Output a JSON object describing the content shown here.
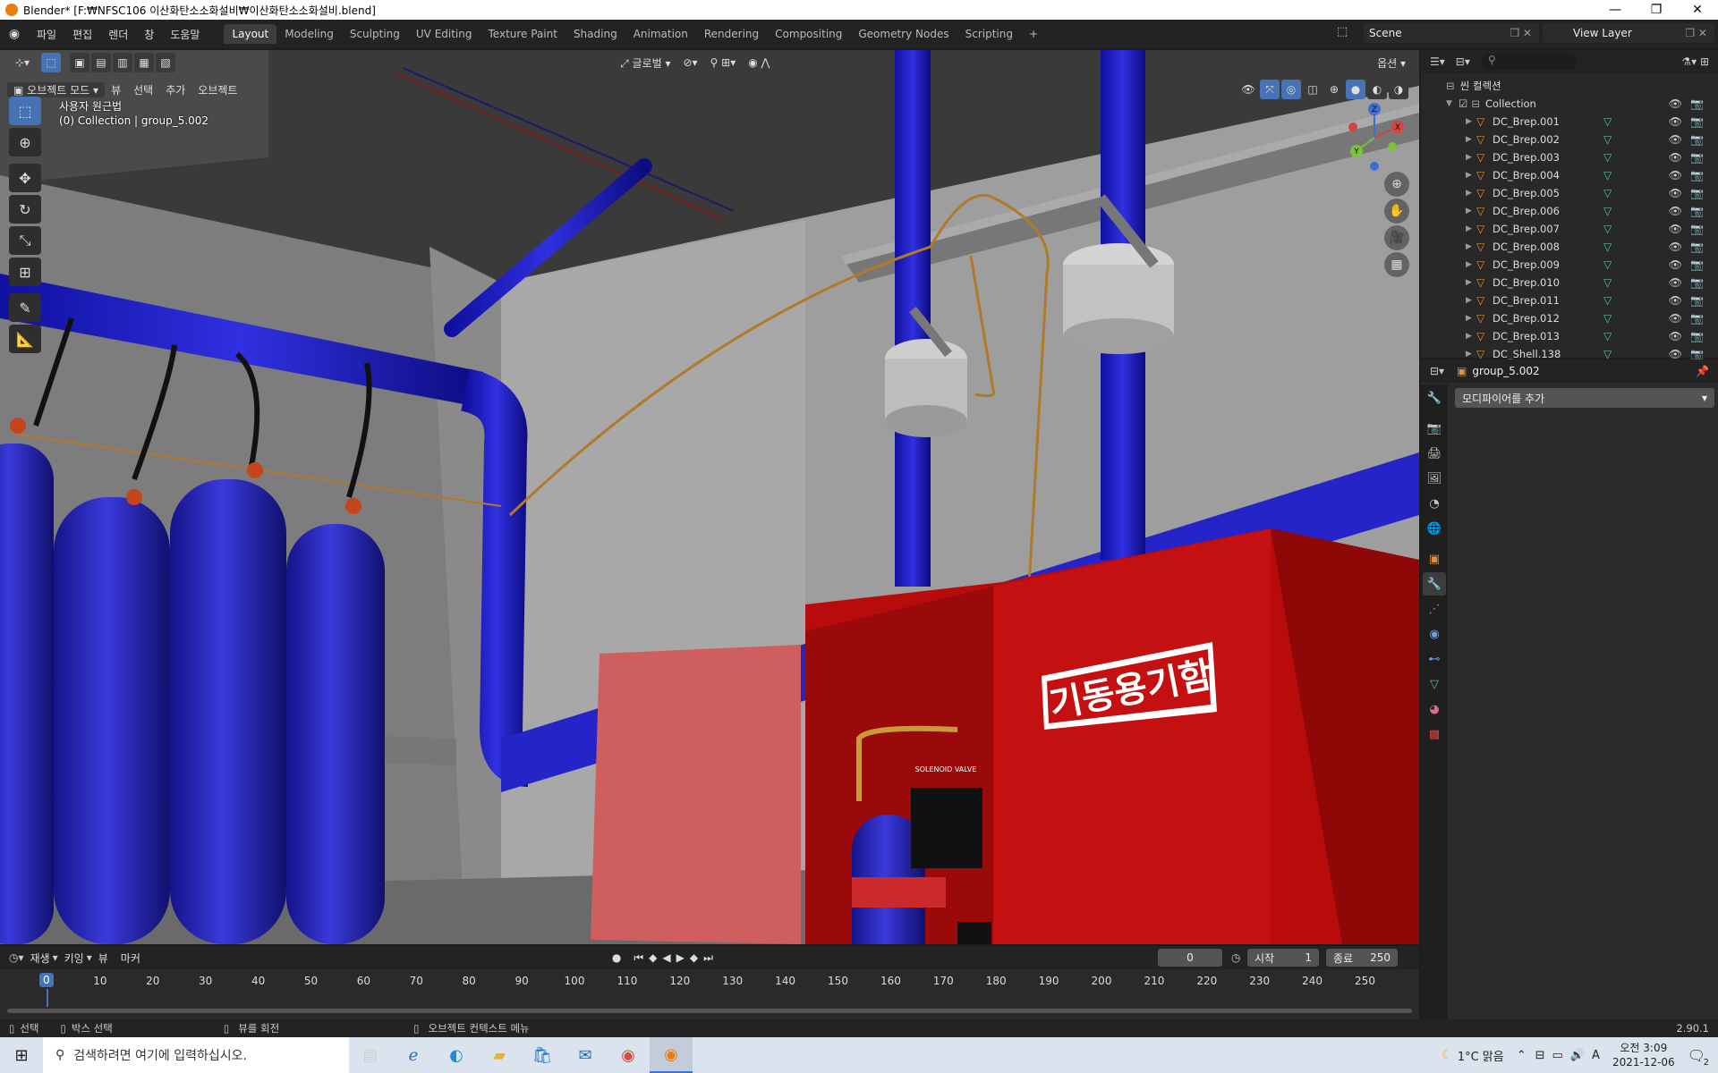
{
  "window": {
    "title": "Blender* [F:₩NFSC106 이산화탄소소화설비₩이산화탄소소화설비.blend]"
  },
  "menu": [
    "파일",
    "편집",
    "렌더",
    "창",
    "도움말"
  ],
  "workspaces": [
    "Layout",
    "Modeling",
    "Sculpting",
    "UV Editing",
    "Texture Paint",
    "Shading",
    "Animation",
    "Rendering",
    "Compositing",
    "Geometry Nodes",
    "Scripting"
  ],
  "active_workspace": "Layout",
  "scene": {
    "name": "Scene"
  },
  "view_layer": {
    "name": "View Layer"
  },
  "viewport": {
    "mode": "오브젝트 모드",
    "menus": [
      "뷰",
      "선택",
      "추가",
      "오브젝트"
    ],
    "transform_orientation": "글로벌",
    "options_label": "옵션",
    "view_name": "사용자 원근법",
    "collection_info": "(0) Collection | group_5.002",
    "cabinet_sign": "기동용기함",
    "valve_label": "SOLENOID VALVE",
    "gizmo_axes": [
      "Z",
      "Y",
      "X"
    ]
  },
  "outliner": {
    "root": "씬 컬렉션",
    "collection": "Collection",
    "items": [
      "DC_Brep.001",
      "DC_Brep.002",
      "DC_Brep.003",
      "DC_Brep.004",
      "DC_Brep.005",
      "DC_Brep.006",
      "DC_Brep.007",
      "DC_Brep.008",
      "DC_Brep.009",
      "DC_Brep.010",
      "DC_Brep.011",
      "DC_Brep.012",
      "DC_Brep.013",
      "DC_Shell.138"
    ]
  },
  "properties": {
    "object_name": "group_5.002",
    "add_modifier": "모디파이어를 추가"
  },
  "timeline": {
    "menus": [
      "재생",
      "키잉",
      "뷰",
      "마커"
    ],
    "current_frame": "0",
    "start_label": "시작",
    "start": "1",
    "end_label": "종료",
    "end": "250",
    "ticks": [
      "0",
      "10",
      "20",
      "30",
      "40",
      "50",
      "60",
      "70",
      "80",
      "90",
      "100",
      "110",
      "120",
      "130",
      "140",
      "150",
      "160",
      "170",
      "180",
      "190",
      "200",
      "210",
      "220",
      "230",
      "240",
      "250"
    ]
  },
  "statusbar": {
    "select": "선택",
    "box_select": "박스 선택",
    "rotate_view": "뷰를 회전",
    "context_menu": "오브젝트 컨텍스트 메뉴",
    "version": "2.90.1"
  },
  "taskbar": {
    "search_placeholder": "검색하려면 여기에 입력하십시오.",
    "weather": "1°C 맑음",
    "ime": "A",
    "time": "오전 3:09",
    "date": "2021-12-06",
    "notifications": "2"
  }
}
